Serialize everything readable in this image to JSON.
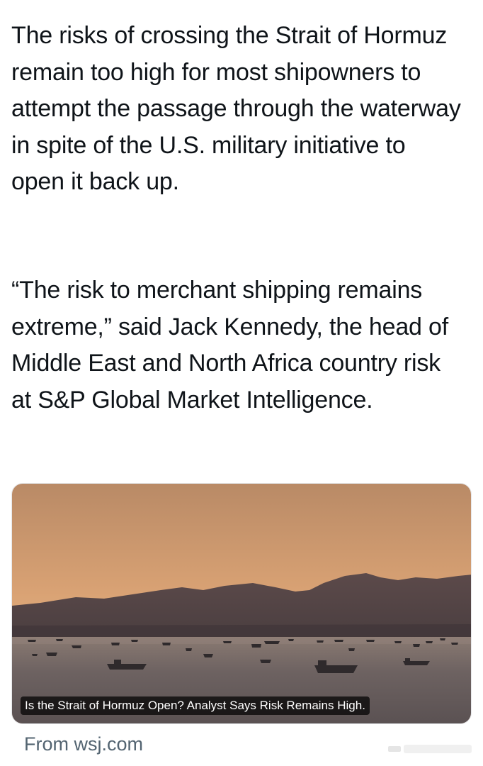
{
  "tweet": {
    "paragraphs": [
      "The risks of crossing the Strait of Hormuz remain too high for most shipowners to attempt the passage through the waterway in spite of the U.S. military initiative to open it back up.",
      "“The risk to merchant shipping remains extreme,” said Jack Kennedy, the head of Middle East and North Africa country risk at S&P Global Market Intelligence."
    ]
  },
  "card": {
    "caption": "Is the Strait of Hormuz Open? Analyst Says Risk Remains High.",
    "source": "From wsj.com"
  },
  "colors": {
    "text": "#0f1419",
    "secondary": "#536471",
    "sky_top": "#b68a67",
    "sky_glow": "#e6b07e",
    "mountain": "#4c3f40",
    "water": "#6a5f5f"
  }
}
